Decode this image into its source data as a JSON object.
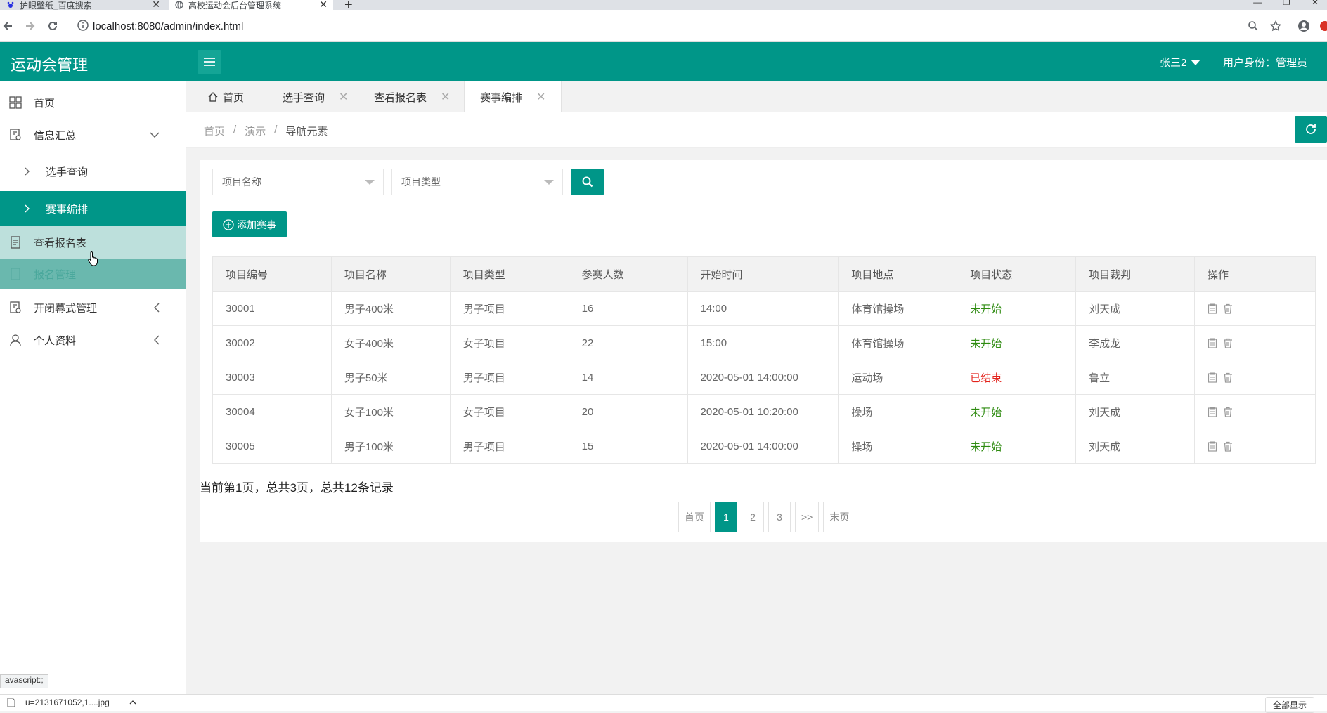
{
  "browser": {
    "tabs": [
      {
        "title": "护眼壁纸_百度搜索"
      },
      {
        "title": "高校运动会后台管理系统"
      }
    ],
    "url": "localhost:8080/admin/index.html"
  },
  "app": {
    "logo": "运动会管理",
    "user": "张三2",
    "role": "用户身份：管理员"
  },
  "sidebar": {
    "items": [
      {
        "label": "首页"
      },
      {
        "label": "信息汇总"
      },
      {
        "label": "选手查询"
      },
      {
        "label": "赛事编排"
      },
      {
        "label": "查看报名表"
      },
      {
        "label": "报名管理"
      },
      {
        "label": "开闭幕式管理"
      },
      {
        "label": "个人资料"
      }
    ]
  },
  "page_tabs": [
    {
      "label": "首页"
    },
    {
      "label": "选手查询"
    },
    {
      "label": "查看报名表"
    },
    {
      "label": "赛事编排"
    }
  ],
  "breadcrumb": [
    "首页",
    "演示",
    "导航元素"
  ],
  "filters": {
    "name_placeholder": "项目名称",
    "type_placeholder": "项目类型"
  },
  "add_button": "添加赛事",
  "table": {
    "headers": [
      "项目编号",
      "项目名称",
      "项目类型",
      "参赛人数",
      "开始时间",
      "项目地点",
      "项目状态",
      "项目裁判",
      "操作"
    ],
    "rows": [
      [
        "30001",
        "男子400米",
        "男子项目",
        "16",
        "14:00",
        "体育馆操场",
        "未开始",
        "刘天成"
      ],
      [
        "30002",
        "女子400米",
        "女子项目",
        "22",
        "15:00",
        "体育馆操场",
        "未开始",
        "李成龙"
      ],
      [
        "30003",
        "男子50米",
        "男子项目",
        "14",
        "2020-05-01 14:00:00",
        "运动场",
        "已结束",
        "鲁立"
      ],
      [
        "30004",
        "女子100米",
        "女子项目",
        "20",
        "2020-05-01 10:20:00",
        "操场",
        "未开始",
        "刘天成"
      ],
      [
        "30005",
        "男子100米",
        "男子项目",
        "15",
        "2020-05-01 14:00:00",
        "操场",
        "未开始",
        "刘天成"
      ]
    ]
  },
  "page_info": "当前第1页，总共3页，总共12条记录",
  "pager": [
    "首页",
    "1",
    "2",
    "3",
    ">>",
    "末页"
  ],
  "status_tip": "avascript:;",
  "download": {
    "file": "u=2131671052,1....jpg",
    "show_all": "全部显示"
  },
  "colors": {
    "primary": "#009688",
    "status_pending": "#2e8b10",
    "status_done": "#e3231c"
  }
}
